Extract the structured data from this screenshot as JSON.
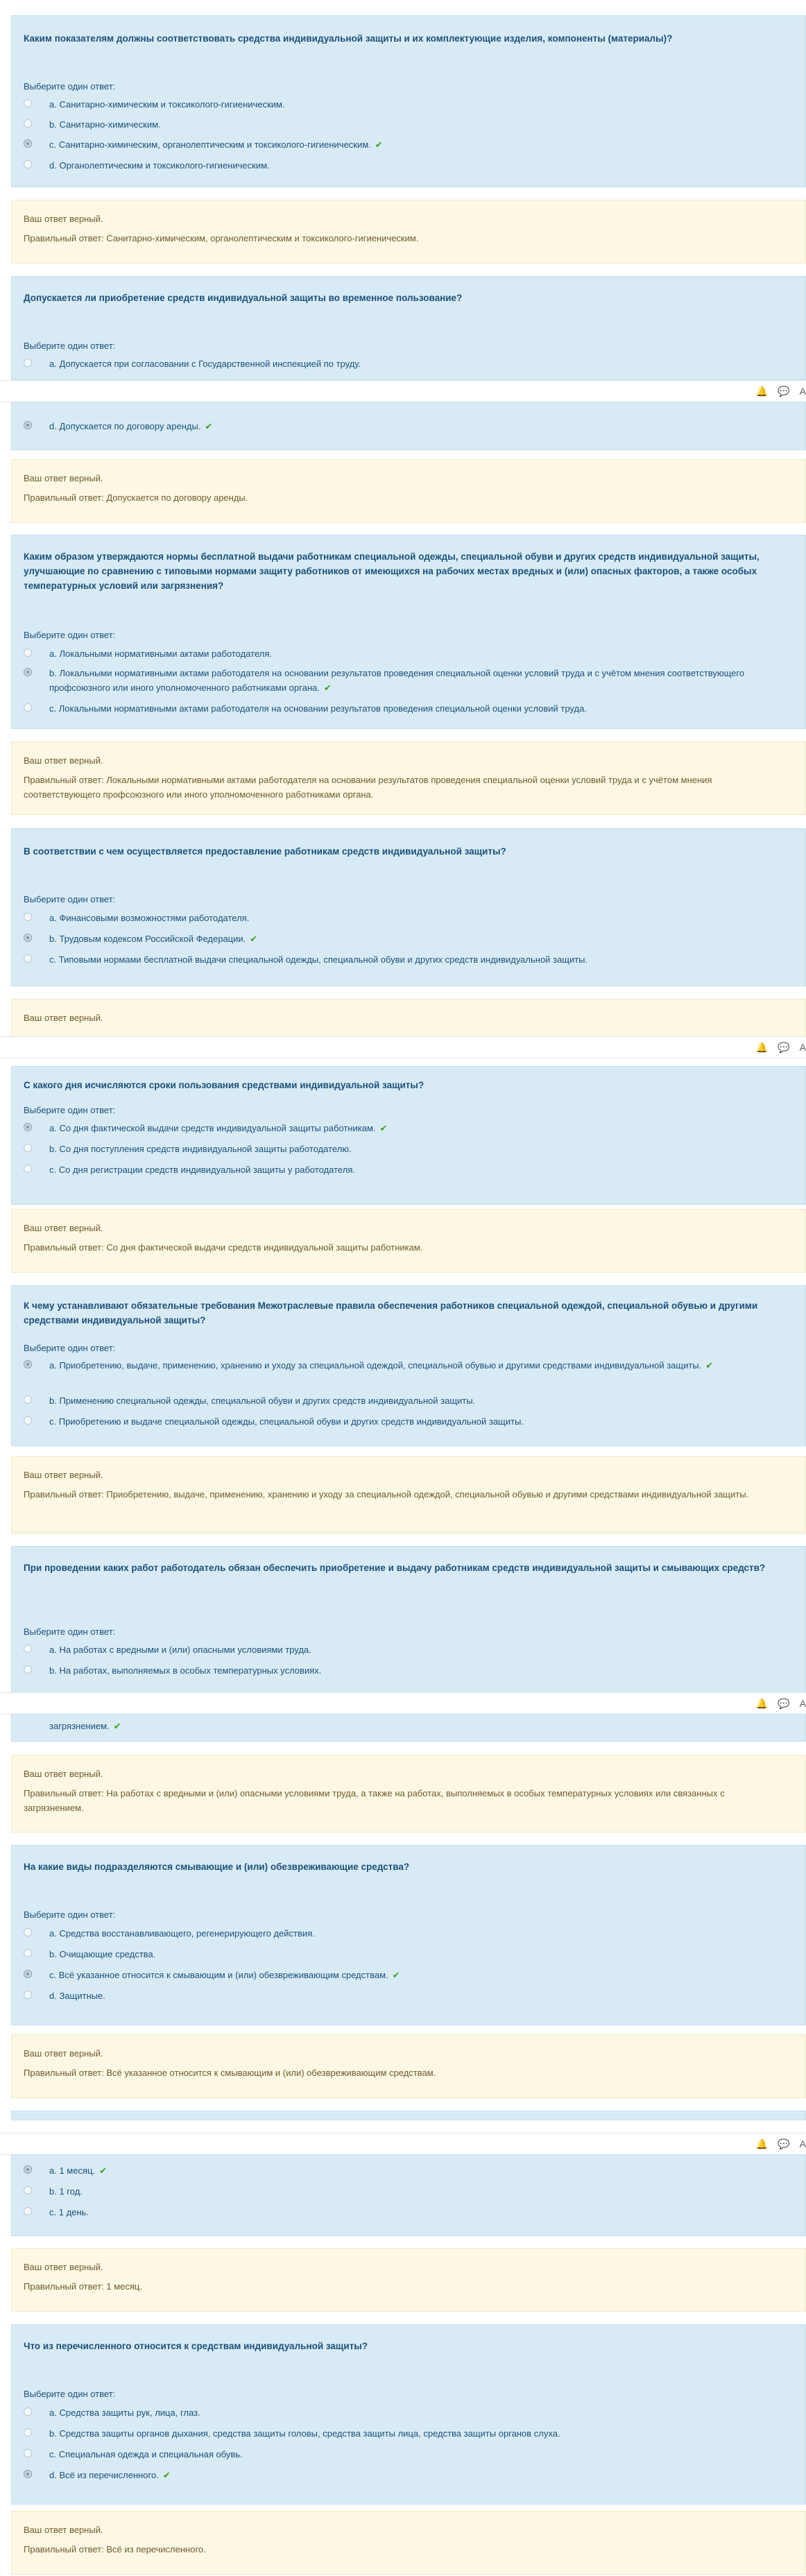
{
  "q1": {
    "title": "Каким показателям должны соответствовать средства индивидуальной защиты и их комплектующие изделия, компоненты (материалы)?",
    "prompt": "Выберите один ответ:",
    "options": [
      "a. Санитарно-химическим и токсиколого-гигиеническим.",
      "b. Санитарно-химическим.",
      "c. Санитарно-химическим, органолептическим и токсиколого-гигиеническим.",
      "d. Органолептическим и токсиколого-гигиеническим."
    ],
    "fb_status": "Ваш ответ верный.",
    "fb_answer": "Правильный ответ: Санитарно-химическим, органолептическим и токсиколого-гигиеническим."
  },
  "q2": {
    "title": "Допускается ли приобретение средств индивидуальной защиты во временное пользование?",
    "prompt": "Выберите один ответ:",
    "options": [
      "a. Допускается при согласовании с Государственной инспекцией по труду.",
      "d. Допускается по договору аренды."
    ],
    "fb_status": "Ваш ответ верный.",
    "fb_answer": "Правильный ответ: Допускается по договору аренды."
  },
  "q3": {
    "title": "Каким образом утверждаются нормы бесплатной выдачи работникам специальной одежды, специальной обуви и других средств индивидуальной защиты, улучшающие по сравнению с типовыми нормами защиту работников от имеющихся на рабочих местах вредных и (или) опасных факторов, а также особых температурных условий или загрязнения?",
    "prompt": "Выберите один ответ:",
    "options": [
      "a. Локальными нормативными актами работодателя.",
      "b. Локальными нормативными актами работодателя на основании результатов проведения специальной оценки условий труда и с учётом мнения соответствующего профсоюзного или иного уполномоченного работниками органа.",
      "c. Локальными нормативными актами работодателя на основании результатов проведения специальной оценки условий труда."
    ],
    "fb_status": "Ваш ответ верный.",
    "fb_answer": "Правильный ответ: Локальными нормативными актами работодателя на основании результатов проведения специальной оценки условий труда и с учётом мнения соответствующего профсоюзного или иного уполномоченного работниками органа."
  },
  "q4": {
    "title": "В соответствии с чем осуществляется предоставление работникам средств индивидуальной защиты?",
    "prompt": "Выберите один ответ:",
    "options": [
      "a. Финансовыми возможностями работодателя.",
      "b. Трудовым кодексом Российской Федерации.",
      "c. Типовыми нормами бесплатной выдачи специальной одежды, специальной обуви и других средств индивидуальной защиты."
    ],
    "fb_status": "Ваш ответ верный."
  },
  "q5": {
    "title": "С какого дня исчисляются сроки пользования средствами индивидуальной защиты?",
    "prompt": "Выберите один ответ:",
    "options": [
      "a. Со дня фактической выдачи средств индивидуальной защиты работникам.",
      "b. Со дня поступления средств индивидуальной защиты работодателю.",
      "c. Со дня регистрации средств индивидуальной защиты у работодателя."
    ],
    "fb_status": "Ваш ответ верный.",
    "fb_answer": "Правильный ответ: Со дня фактической выдачи средств индивидуальной защиты работникам."
  },
  "q6": {
    "title": "К чему устанавливают обязательные требования Межотраслевые правила обеспечения работников специальной одеждой, специальной обувью и другими средствами индивидуальной защиты?",
    "prompt": "Выберите один ответ:",
    "options": [
      "a. Приобретению, выдаче, применению, хранению и уходу за специальной одеждой, специальной обувью и другими средствами индивидуальной защиты.",
      "b. Применению специальной одежды, специальной обуви и других средств индивидуальной защиты.",
      "c. Приобретению и выдаче специальной одежды, специальной обуви и других средств индивидуальной защиты."
    ],
    "fb_status": "Ваш ответ верный.",
    "fb_answer": "Правильный ответ: Приобретению, выдаче, применению, хранению и уходу за специальной одеждой, специальной обувью и другими средствами индивидуальной защиты."
  },
  "q7": {
    "title": "При проведении каких работ работодатель обязан обеспечить приобретение и выдачу работникам средств индивидуальной защиты и смывающих средств?",
    "prompt": "Выберите один ответ:",
    "options": [
      "a. На работах с вредными и (или) опасными условиями труда.",
      "b. На работах, выполняемых в особых температурных условиях.",
      "загрязнением."
    ],
    "fb_status": "Ваш ответ верный.",
    "fb_answer": "Правильный ответ: На работах с вредными и (или) опасными условиями труда, а также на работах, выполняемых в особых температурных условиях или связанных с загрязнением."
  },
  "q8": {
    "title": "На какие виды подразделяются смывающие и (или) обезвреживающие средства?",
    "prompt": "Выберите один ответ:",
    "options": [
      "a. Средства восстанавливающего, регенерирующего действия.",
      "b. Очищающие средства.",
      "c. Всё указанное относится к смывающим и (или) обезвреживающим средствам.",
      "d. Защитные."
    ],
    "fb_status": "Ваш ответ верный.",
    "fb_answer": "Правильный ответ: Всё указанное относится к смывающим и (или) обезвреживающим средствам."
  },
  "q9": {
    "options": [
      "a. 1 месяц.",
      "b. 1 год.",
      "c. 1 день."
    ],
    "fb_status": "Ваш ответ верный.",
    "fb_answer": "Правильный ответ: 1 месяц."
  },
  "q10": {
    "title": "Что из перечисленного относится к средствам индивидуальной защиты?",
    "prompt": "Выберите один ответ:",
    "options": [
      "a. Средства защиты рук, лица, глаз.",
      "b. Средства защиты органов дыхания, средства защиты головы, средства защиты лица, средства защиты органов слуха.",
      "c. Специальная одежда и специальная обувь.",
      "d. Всё из перечисленного."
    ],
    "fb_status": "Ваш ответ верный.",
    "fb_answer": "Правильный ответ: Всё из перечисленного."
  },
  "toolbar": {
    "icons": [
      "bell-icon",
      "chat-icon"
    ],
    "label": "А"
  },
  "colors": {
    "question_bg": "#d8ebf4",
    "feedback_bg": "#fcf8e3",
    "check": "#3a9e1f",
    "text": "#1a4f7a"
  }
}
